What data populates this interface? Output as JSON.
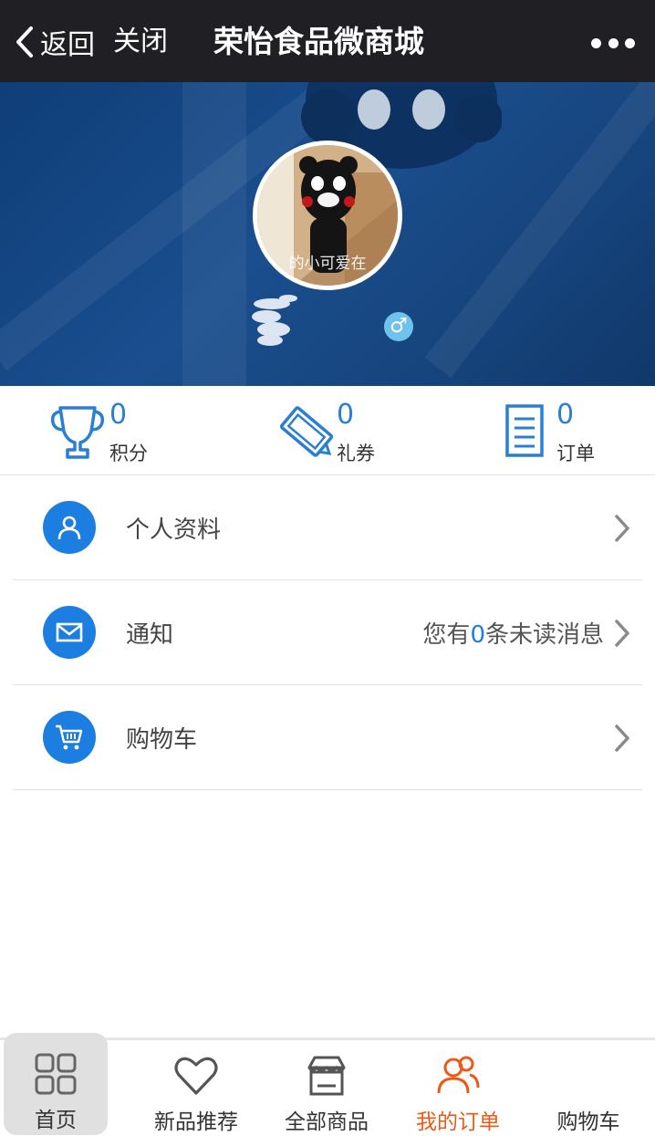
{
  "topbar": {
    "back_label": "返回",
    "close_label": "关闭",
    "title": "荣怡食品微商城"
  },
  "profile": {
    "avatar_caption": "的小可爱在",
    "gender_symbol": "♂"
  },
  "stats": [
    {
      "value": "0",
      "label": "积分",
      "icon": "trophy-icon"
    },
    {
      "value": "0",
      "label": "礼券",
      "icon": "coupon-icon"
    },
    {
      "value": "0",
      "label": "订单",
      "icon": "order-document-icon"
    }
  ],
  "menu": {
    "profile": {
      "label": "个人资料",
      "icon": "user-icon"
    },
    "notice": {
      "label": "通知",
      "status_prefix": "您有",
      "status_count": "0",
      "status_suffix": "条未读消息",
      "icon": "envelope-icon"
    },
    "cart": {
      "label": "购物车",
      "icon": "cart-icon"
    }
  },
  "tabs": [
    {
      "label": "首页",
      "icon": "grid-icon"
    },
    {
      "label": "新品推荐",
      "icon": "heart-icon"
    },
    {
      "label": "全部商品",
      "icon": "store-icon"
    },
    {
      "label": "我的订单",
      "icon": "users-icon",
      "active": true
    },
    {
      "label": "购物车",
      "icon": "cart-icon"
    }
  ],
  "colors": {
    "topbar_bg": "#1f1f24",
    "accent_blue": "#1c7ee0",
    "active_tab": "#ec5a18",
    "hero_blue": "#1a4e8e"
  }
}
